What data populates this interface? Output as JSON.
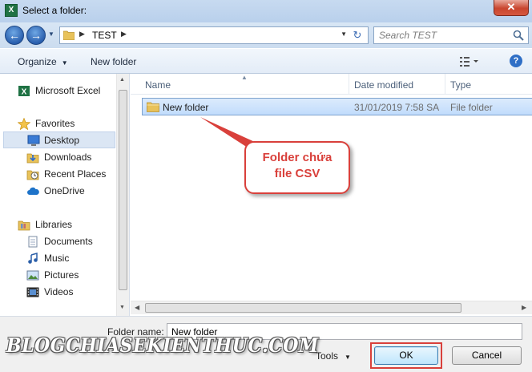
{
  "window": {
    "title": "Select a folder:",
    "app_icon": "X",
    "close_glyph": "✕"
  },
  "address_bar": {
    "path": [
      "TEST"
    ],
    "search_placeholder": "Search TEST"
  },
  "toolbar": {
    "organize_label": "Organize",
    "new_folder_label": "New folder",
    "help_glyph": "?"
  },
  "nav_pane": {
    "items": [
      {
        "label": "Microsoft Excel",
        "icon": "excel-icon",
        "group": true
      },
      {
        "label": "Favorites",
        "icon": "star-icon",
        "group": true
      },
      {
        "label": "Desktop",
        "icon": "desktop-icon",
        "selected": true
      },
      {
        "label": "Downloads",
        "icon": "downloads-icon"
      },
      {
        "label": "Recent Places",
        "icon": "recent-places-icon"
      },
      {
        "label": "OneDrive",
        "icon": "cloud-icon",
        "group": true
      },
      {
        "label": "Libraries",
        "icon": "libraries-icon",
        "group": true
      },
      {
        "label": "Documents",
        "icon": "documents-icon"
      },
      {
        "label": "Music",
        "icon": "music-icon"
      },
      {
        "label": "Pictures",
        "icon": "pictures-icon"
      },
      {
        "label": "Videos",
        "icon": "videos-icon"
      }
    ]
  },
  "file_list": {
    "columns": [
      "Name",
      "Date modified",
      "Type"
    ],
    "rows": [
      {
        "name": "New folder",
        "date_modified": "31/01/2019 7:58 SA",
        "type": "File folder",
        "selected": true
      }
    ]
  },
  "annotation": {
    "line1": "Folder chứa",
    "line2": "file CSV",
    "color": "#d9403b"
  },
  "footer": {
    "folder_name_label": "Folder name:",
    "folder_name_value": "New folder",
    "tools_label": "Tools",
    "ok_label": "OK",
    "cancel_label": "Cancel"
  },
  "watermark": "BLOGCHIASEKIENTHUC.COM",
  "colors": {
    "accent": "#2f6fc6",
    "highlight": "#d9403b",
    "selection": "#c1dcfc"
  }
}
